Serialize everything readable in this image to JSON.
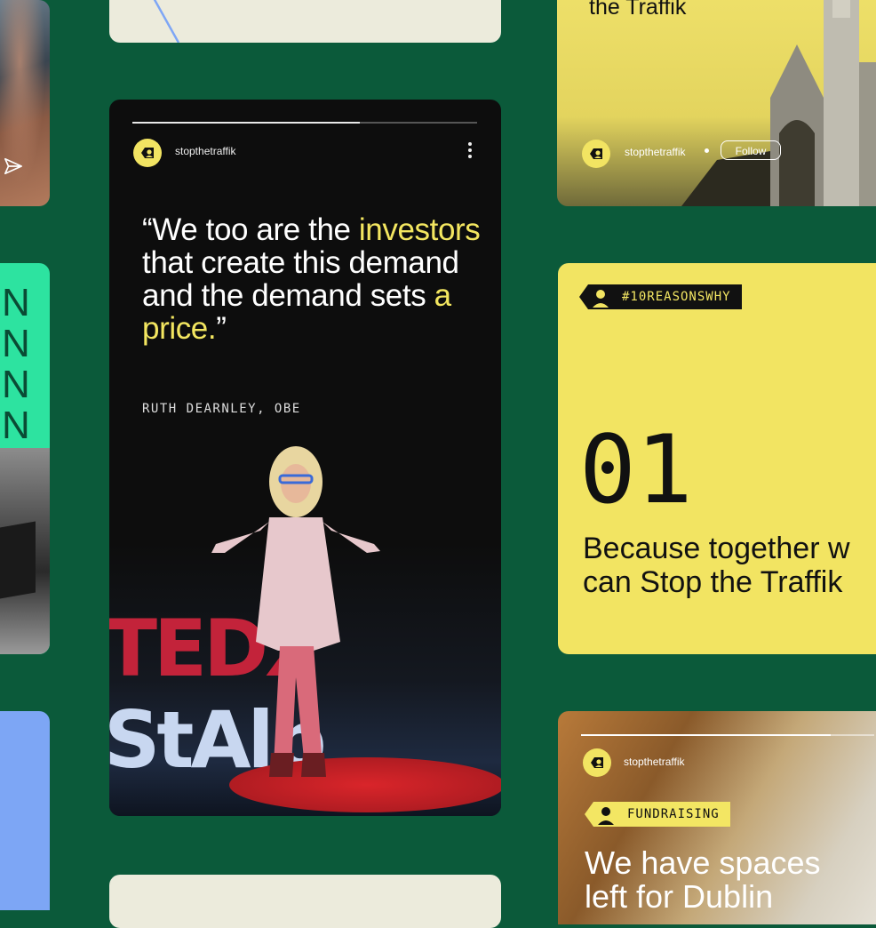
{
  "colors": {
    "background": "#0b5a3a",
    "yellow": "#f2e462",
    "dark": "#0d0d0d",
    "mint": "#2de3a0",
    "blue": "#7da6f5"
  },
  "left_green": {
    "letters": [
      "N",
      "N",
      "N",
      "N"
    ]
  },
  "story": {
    "progress_fraction": 0.66,
    "handle": "stopthetraffik",
    "quote": {
      "part1": "“We too are the ",
      "highlight1": "investors",
      "part2": " that create this demand and the demand sets ",
      "highlight2": "a price.",
      "part3": "”"
    },
    "attribution": "RUTH DEARNLEY, OBE",
    "stage_text_red": "TEDx",
    "stage_text_blue": "StAlb"
  },
  "right_top": {
    "title_fragment": "the Traffik",
    "handle": "stopthetraffik",
    "follow_label": "Follow"
  },
  "right_mid": {
    "hashtag": "#10REASONSWHY",
    "number": "01",
    "reason_line1": "Because together w",
    "reason_line2": "can Stop the Traffik"
  },
  "right_bottom": {
    "progress_fraction": 0.85,
    "handle": "stopthetraffik",
    "tag": "FUNDRAISING",
    "headline_line1": "We have spaces",
    "headline_line2": "left for Dublin"
  }
}
